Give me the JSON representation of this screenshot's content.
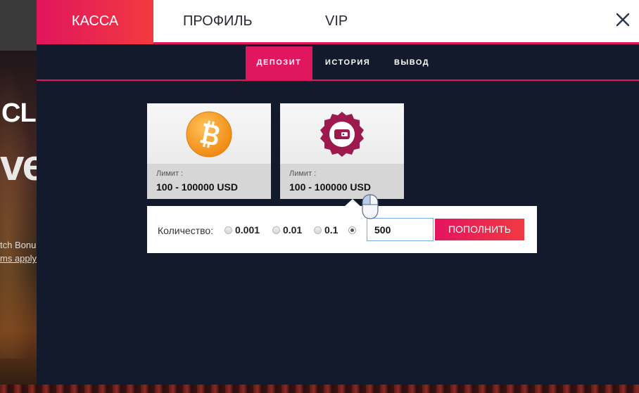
{
  "background_site": {
    "big_text_1": "CL",
    "big_text_2": "ve",
    "small_text_1": "tch Bonu",
    "small_text_2": "ms apply"
  },
  "header": {
    "tabs": [
      {
        "label": "КАССА",
        "active": true
      },
      {
        "label": "ПРОФИЛЬ",
        "active": false
      },
      {
        "label": "VIP",
        "active": false
      }
    ],
    "close_icon": "close-icon"
  },
  "subnav": {
    "tabs": [
      {
        "label": "ДЕПОЗИТ",
        "active": true
      },
      {
        "label": "ИСТОРИЯ",
        "active": false
      },
      {
        "label": "ВЫВОД",
        "active": false
      }
    ]
  },
  "payment_methods": [
    {
      "icon": "bitcoin-icon",
      "limit_label": "Лимит :",
      "limit_value": "100 - 100000 USD",
      "selected": false
    },
    {
      "icon": "wallet-seal-icon",
      "limit_label": "Лимит :",
      "limit_value": "100 - 100000 USD",
      "selected": true
    }
  ],
  "deposit_form": {
    "quantity_label": "Количество:",
    "options": [
      {
        "label": "0.001",
        "checked": false
      },
      {
        "label": "0.01",
        "checked": false
      },
      {
        "label": "0.1",
        "checked": false
      },
      {
        "label": "",
        "checked": true
      }
    ],
    "amount_value": "500",
    "submit_label": "ПОПОЛНИТЬ"
  },
  "colors": {
    "accent": "#e0165e",
    "accent_gradient_end": "#f23a3f",
    "modal_bg": "#131a2b",
    "header_bg": "#ffffff",
    "bitcoin_orange": "#f7931a",
    "wallet_seal": "#9c1a4e"
  }
}
